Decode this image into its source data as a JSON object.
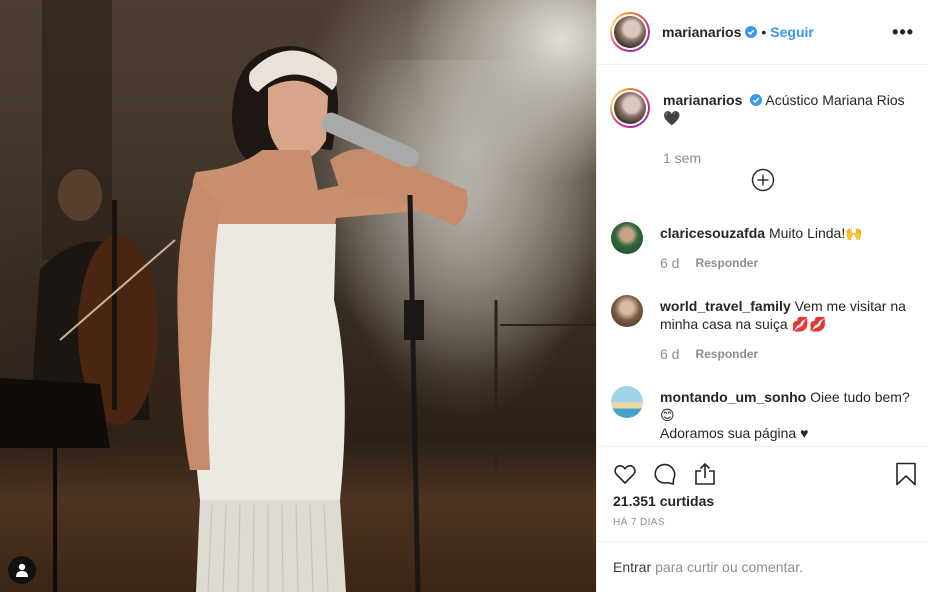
{
  "post": {
    "username": "marianarios",
    "follow_label": "Seguir",
    "separator": "•",
    "more_label": "•••"
  },
  "caption": {
    "username": "marianarios",
    "text": "Acústico Mariana Rios",
    "emoji": "🖤",
    "time": "1 sem"
  },
  "comments": [
    {
      "username": "claricesouzafda",
      "text": "Muito Linda!",
      "emoji": "🙌",
      "time": "6 d",
      "reply_label": "Responder"
    },
    {
      "username": "world_travel_family",
      "text": "Vem me visitar na minha casa na suiça",
      "emoji": "💋💋",
      "time": "6 d",
      "reply_label": "Responder"
    },
    {
      "username": "montando_um_sonho",
      "text": "Oiee tudo bem?",
      "emoji": "😊",
      "text2": "Adoramos sua página ♥"
    }
  ],
  "likes_text": "21.351 curtidas",
  "posted_ago": "HÁ 7 DIAS",
  "add_comment": {
    "login_label": "Entrar",
    "placeholder": "para curtir ou comentar."
  },
  "icons": {
    "header": [
      "verified-badge",
      "more-options-icon"
    ],
    "actions": [
      "heart-icon",
      "comment-icon",
      "share-icon",
      "bookmark-icon"
    ],
    "load_more": "plus-circle-icon",
    "photo_overlay": "user-icon"
  },
  "colors": {
    "accent": "#3897f0",
    "muted": "#8e8e8e",
    "border": "#efefef"
  }
}
